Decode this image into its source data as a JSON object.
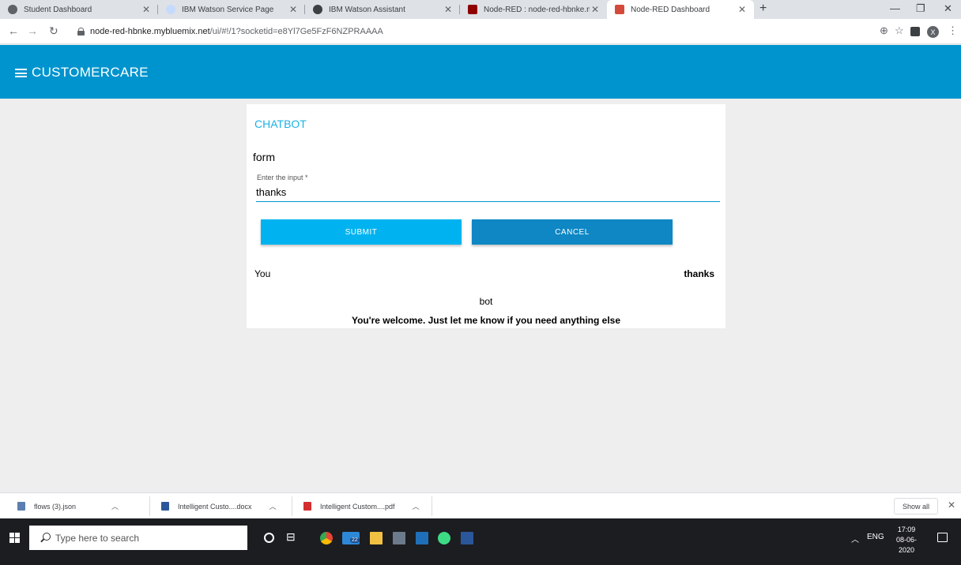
{
  "browser": {
    "tabs": [
      {
        "title": "Student Dashboard",
        "icon": "globe-icon",
        "color": "#5f6368"
      },
      {
        "title": "IBM Watson Service Page",
        "icon": "cloud-icon",
        "color": "#8ab4f8"
      },
      {
        "title": "IBM Watson Assistant",
        "icon": "watson-icon",
        "color": "#3c4043"
      },
      {
        "title": "Node-RED : node-red-hbnke.myblu",
        "icon": "node-red-icon",
        "color": "#8f0000"
      },
      {
        "title": "Node-RED Dashboard",
        "icon": "node-red-dashboard-icon",
        "color": "#d44a3a",
        "active": true
      }
    ],
    "url": {
      "host": "node-red-hbnke.mybluemix.net",
      "path": "/ui/#!/1?socketid=e8Yl7Ge5FzF6NZPRAAAA"
    },
    "avatar_letter": "X"
  },
  "app": {
    "title": "CUSTOMERCARE",
    "header_color": "#0094ce"
  },
  "card": {
    "title": "CHATBOT",
    "form_label": "form",
    "field_label": "Enter the input *",
    "field_value": "thanks",
    "submit_label": "SUBMIT",
    "cancel_label": "CANCEL",
    "you_label": "You",
    "you_value": "thanks",
    "bot_label": "bot",
    "bot_value": "You're welcome. Just let me know if you need anything else"
  },
  "downloads": {
    "items": [
      {
        "name": "flows (3).json",
        "icon": "json-file-icon"
      },
      {
        "name": "Intelligent Custo....docx",
        "icon": "word-file-icon"
      },
      {
        "name": "Intelligent Custom....pdf",
        "icon": "pdf-file-icon"
      }
    ],
    "show_all_label": "Show all"
  },
  "taskbar": {
    "search_placeholder": "Type here to search",
    "language": "ENG",
    "time": "17:09",
    "date": "08-06-2020",
    "badge_count": "22"
  }
}
